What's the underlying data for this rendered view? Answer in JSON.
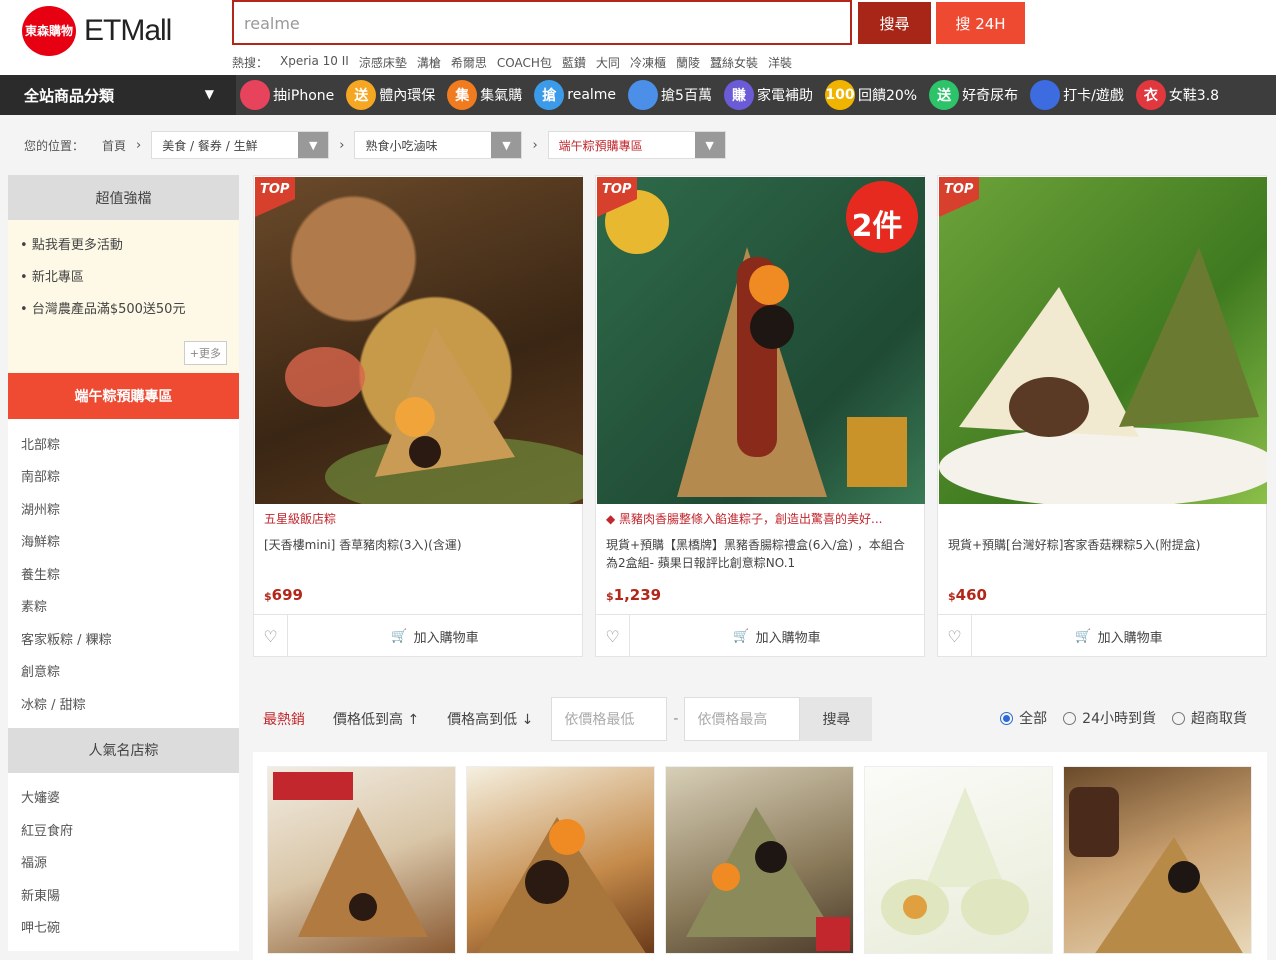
{
  "header": {
    "logo_badge": "東森購物",
    "logo_text": "ETMall",
    "search_value": "realme",
    "search_button": "搜尋",
    "search_24h_button": "搜 24H",
    "hot_label": "熱搜：",
    "hot_words": [
      "Xperia 10 II",
      "涼感床墊",
      "溝槍",
      "希爾思",
      "COACH包",
      "藍鑽",
      "大同",
      "冷凍櫃",
      "蘭陵",
      "蠶絲女裝",
      "洋裝"
    ]
  },
  "nav": {
    "category_label": "全站商品分類",
    "promos": [
      {
        "icon_text": "",
        "label": "抽iPhone",
        "color": "#e8435d"
      },
      {
        "icon_text": "送",
        "label": "體內環保",
        "color": "#f5a623"
      },
      {
        "icon_text": "集",
        "label": "集氣購",
        "color": "#f07c1f"
      },
      {
        "icon_text": "搶",
        "label": "realme",
        "color": "#3b9be8"
      },
      {
        "icon_text": "",
        "label": "搶5百萬",
        "color": "#4b8fe8"
      },
      {
        "icon_text": "賺",
        "label": "家電補助",
        "color": "#6b5bd6"
      },
      {
        "icon_text": "100",
        "label": "回饋20%",
        "color": "#f0b400"
      },
      {
        "icon_text": "送",
        "label": "好奇尿布",
        "color": "#2cc36b"
      },
      {
        "icon_text": "",
        "label": "打卡/遊戲",
        "color": "#3d6be0"
      },
      {
        "icon_text": "衣",
        "label": "女鞋3.8",
        "color": "#e0383e"
      }
    ]
  },
  "breadcrumb": {
    "label": "您的位置：",
    "home": "首頁",
    "level1": "美食 / 餐券 / 生鮮",
    "level2": "熟食小吃滷味",
    "level3": "端午粽預購專區"
  },
  "sidebar": {
    "promo_title": "超值強檔",
    "promo_items": [
      "點我看更多活動",
      "新北專區",
      "台灣農產品滿$500送50元"
    ],
    "more_label": "+更多",
    "active_title": "端午粽預購專區",
    "categories": [
      "北部粽",
      "南部粽",
      "湖州粽",
      "海鮮粽",
      "養生粽",
      "素粽",
      "客家粄粽 / 粿粽",
      "創意粽",
      "冰粽 / 甜粽"
    ],
    "popular_title": "人氣名店粽",
    "popular": [
      "大嬸婆",
      "紅豆食府",
      "福源",
      "新東陽",
      "呷七碗"
    ]
  },
  "products": [
    {
      "tag": "TOP",
      "subtitle": "五星級飯店粽",
      "title": "[天香樓mini] 香草豬肉粽(3入)(含運)",
      "price_symbol": "$",
      "price": "699",
      "cart_label": "加入購物車",
      "badge": ""
    },
    {
      "tag": "TOP",
      "subtitle": "◆ 黑豬肉香腸整條入餡進粽子，創造出驚喜的美好...",
      "title": "現貨+預購【黑橋牌】黑豬香腸粽禮盒(6入/盒) ，本組合為2盒組- 蘋果日報評比創意粽NO.1",
      "price_symbol": "$",
      "price": "1,239",
      "cart_label": "加入購物車",
      "badge": "2件"
    },
    {
      "tag": "TOP",
      "subtitle": "",
      "title": "現貨+預購[台灣好粽]客家香菇粿粽5入(附提盒)",
      "price_symbol": "$",
      "price": "460",
      "cart_label": "加入購物車",
      "badge": ""
    }
  ],
  "filter": {
    "sort_hot": "最熱銷",
    "sort_low": "價格低到高 ↑",
    "sort_high": "價格高到低 ↓",
    "min_placeholder": "依價格最低",
    "dash": "-",
    "max_placeholder": "依價格最高",
    "go": "搜尋",
    "radio_all": "全部",
    "radio_24h": "24小時到貨",
    "radio_store": "超商取貨"
  },
  "colors": {
    "brand_red": "#e60012",
    "accent": "#ef4a32",
    "price": "#b3271a"
  }
}
